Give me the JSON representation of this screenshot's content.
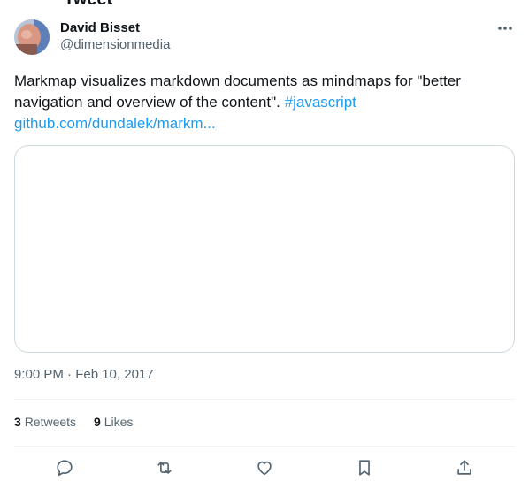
{
  "top_cut_text": "Tweet",
  "author": {
    "display_name": "David Bisset",
    "handle": "@dimensionmedia"
  },
  "tweet": {
    "text": "Markmap visualizes markdown documents as mindmaps for \"better navigation and overview of the content\".",
    "hashtag": "#javascript",
    "url": "github.com/dundalek/markm..."
  },
  "timestamp": "9:00 PM · Feb 10, 2017",
  "stats": {
    "retweets_count": "3",
    "retweets_label": "Retweets",
    "likes_count": "9",
    "likes_label": "Likes"
  },
  "icons": {
    "more": "more-icon",
    "reply": "reply-icon",
    "retweet": "retweet-icon",
    "like": "heart-icon",
    "bookmark": "bookmark-icon",
    "share": "share-icon"
  },
  "colors": {
    "link": "#1d9bf0",
    "secondary_text": "#536471",
    "border": "#cfd9de"
  }
}
